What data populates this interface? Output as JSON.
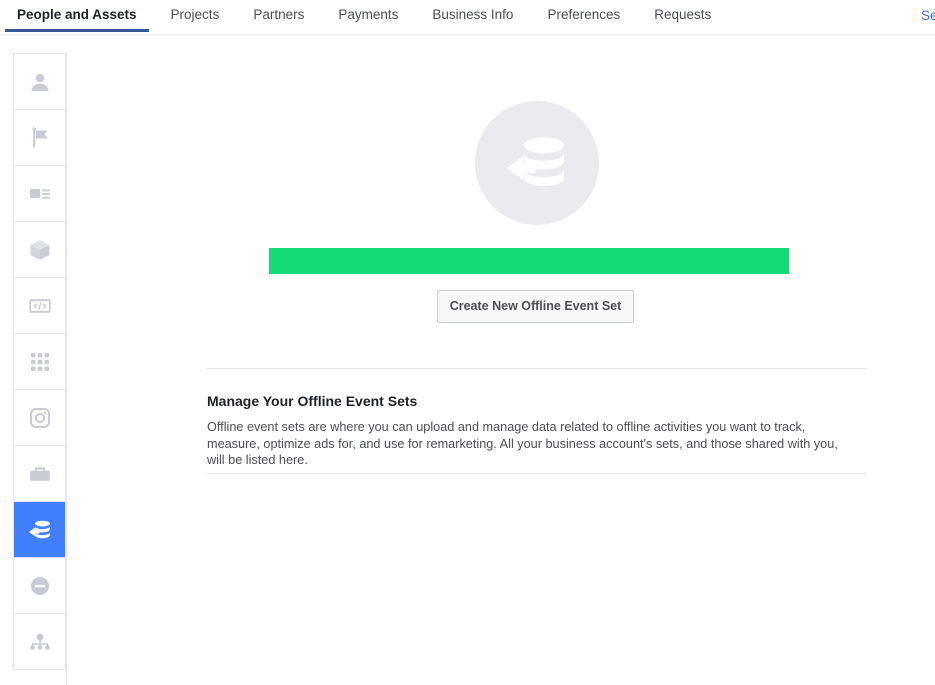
{
  "top_nav": {
    "tabs": [
      {
        "label": "People and Assets",
        "active": true
      },
      {
        "label": "Projects",
        "active": false
      },
      {
        "label": "Partners",
        "active": false
      },
      {
        "label": "Payments",
        "active": false
      },
      {
        "label": "Business Info",
        "active": false
      },
      {
        "label": "Preferences",
        "active": false
      },
      {
        "label": "Requests",
        "active": false
      }
    ],
    "right_link": "Se",
    "active_underline_color": "#365899",
    "link_color": "#4267d2"
  },
  "sidebar": {
    "items": [
      {
        "icon": "person-icon",
        "name": "sidebar-item-people",
        "active": false
      },
      {
        "icon": "page-flag-icon",
        "name": "sidebar-item-pages",
        "active": false
      },
      {
        "icon": "ad-account-icon",
        "name": "sidebar-item-ad-accounts",
        "active": false
      },
      {
        "icon": "product-catalog-icon",
        "name": "sidebar-item-catalogs",
        "active": false
      },
      {
        "icon": "pixel-code-icon",
        "name": "sidebar-item-pixels",
        "active": false
      },
      {
        "icon": "apps-grid-icon",
        "name": "sidebar-item-apps",
        "active": false
      },
      {
        "icon": "instagram-icon",
        "name": "sidebar-item-instagram",
        "active": false
      },
      {
        "icon": "briefcase-icon",
        "name": "sidebar-item-business",
        "active": false
      },
      {
        "icon": "offline-events-icon",
        "name": "sidebar-item-offline-events",
        "active": true
      },
      {
        "icon": "block-circle-icon",
        "name": "sidebar-item-block-lists",
        "active": false
      },
      {
        "icon": "shared-network-icon",
        "name": "sidebar-item-shared",
        "active": false
      }
    ],
    "active_background": "#4080ff",
    "icon_color": "#c6cbd4"
  },
  "main": {
    "hero_icon": "offline-events-large-icon",
    "hero_circle_color": "#e9ebee",
    "highlight_bar_color": "#13dc76",
    "create_button_label": "Create New Offline Event Set",
    "manage_title": "Manage Your Offline Event Sets",
    "manage_body": "Offline event sets are where you can upload and manage data related to offline activities you want to track, measure, optimize ads for, and use for remarketing. All your business account's sets, and those shared with you, will be listed here."
  }
}
